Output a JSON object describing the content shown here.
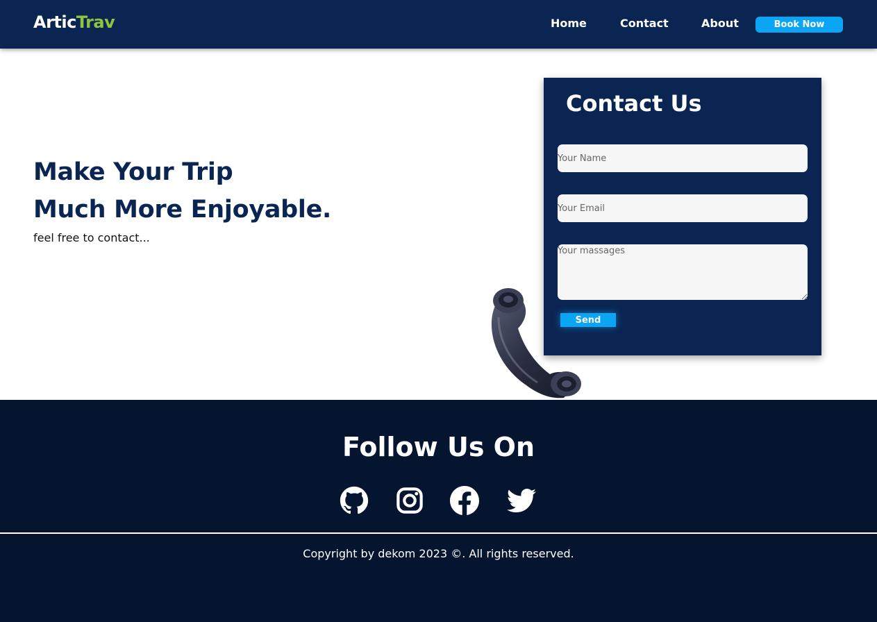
{
  "header": {
    "logo_part1": "Artic",
    "logo_part2": "Trav",
    "nav": [
      {
        "label": "Home"
      },
      {
        "label": "Contact"
      },
      {
        "label": "About"
      }
    ],
    "book_button": "Book Now"
  },
  "hero": {
    "title_line1": "Make Your Trip",
    "title_line2": "Much More Enjoyable.",
    "subtitle": "feel free to contact..."
  },
  "contact": {
    "title": "Contact Us",
    "name_placeholder": "Your Name",
    "email_placeholder": "Your Email",
    "message_placeholder": "Your massages",
    "send_label": "Send"
  },
  "footer": {
    "follow_title": "Follow Us On",
    "social_icons": [
      "github-icon",
      "instagram-icon",
      "facebook-icon",
      "twitter-icon"
    ],
    "copyright": "Copyright by dekom 2023 ©. All rights reserved."
  },
  "colors": {
    "navy": "#0b2553",
    "footer_bg": "#05142f",
    "accent_blue": "#0aa6f5",
    "logo_green": "#8cc63f"
  }
}
